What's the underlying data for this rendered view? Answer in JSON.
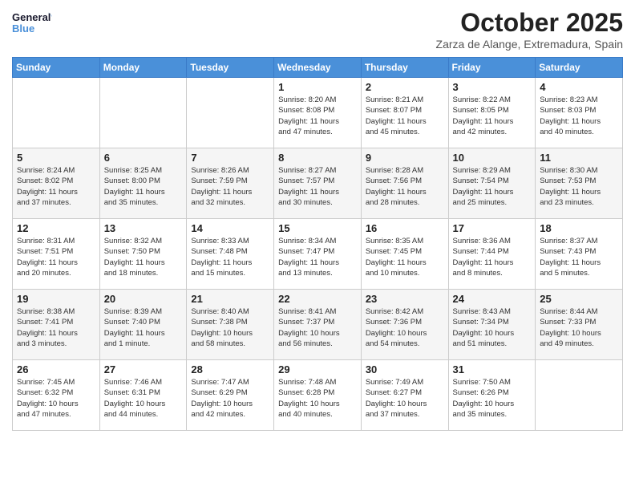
{
  "logo": {
    "line1": "General",
    "line2": "Blue"
  },
  "title": "October 2025",
  "subtitle": "Zarza de Alange, Extremadura, Spain",
  "days_of_week": [
    "Sunday",
    "Monday",
    "Tuesday",
    "Wednesday",
    "Thursday",
    "Friday",
    "Saturday"
  ],
  "weeks": [
    [
      {
        "day": "",
        "info": ""
      },
      {
        "day": "",
        "info": ""
      },
      {
        "day": "",
        "info": ""
      },
      {
        "day": "1",
        "info": "Sunrise: 8:20 AM\nSunset: 8:08 PM\nDaylight: 11 hours\nand 47 minutes."
      },
      {
        "day": "2",
        "info": "Sunrise: 8:21 AM\nSunset: 8:07 PM\nDaylight: 11 hours\nand 45 minutes."
      },
      {
        "day": "3",
        "info": "Sunrise: 8:22 AM\nSunset: 8:05 PM\nDaylight: 11 hours\nand 42 minutes."
      },
      {
        "day": "4",
        "info": "Sunrise: 8:23 AM\nSunset: 8:03 PM\nDaylight: 11 hours\nand 40 minutes."
      }
    ],
    [
      {
        "day": "5",
        "info": "Sunrise: 8:24 AM\nSunset: 8:02 PM\nDaylight: 11 hours\nand 37 minutes."
      },
      {
        "day": "6",
        "info": "Sunrise: 8:25 AM\nSunset: 8:00 PM\nDaylight: 11 hours\nand 35 minutes."
      },
      {
        "day": "7",
        "info": "Sunrise: 8:26 AM\nSunset: 7:59 PM\nDaylight: 11 hours\nand 32 minutes."
      },
      {
        "day": "8",
        "info": "Sunrise: 8:27 AM\nSunset: 7:57 PM\nDaylight: 11 hours\nand 30 minutes."
      },
      {
        "day": "9",
        "info": "Sunrise: 8:28 AM\nSunset: 7:56 PM\nDaylight: 11 hours\nand 28 minutes."
      },
      {
        "day": "10",
        "info": "Sunrise: 8:29 AM\nSunset: 7:54 PM\nDaylight: 11 hours\nand 25 minutes."
      },
      {
        "day": "11",
        "info": "Sunrise: 8:30 AM\nSunset: 7:53 PM\nDaylight: 11 hours\nand 23 minutes."
      }
    ],
    [
      {
        "day": "12",
        "info": "Sunrise: 8:31 AM\nSunset: 7:51 PM\nDaylight: 11 hours\nand 20 minutes."
      },
      {
        "day": "13",
        "info": "Sunrise: 8:32 AM\nSunset: 7:50 PM\nDaylight: 11 hours\nand 18 minutes."
      },
      {
        "day": "14",
        "info": "Sunrise: 8:33 AM\nSunset: 7:48 PM\nDaylight: 11 hours\nand 15 minutes."
      },
      {
        "day": "15",
        "info": "Sunrise: 8:34 AM\nSunset: 7:47 PM\nDaylight: 11 hours\nand 13 minutes."
      },
      {
        "day": "16",
        "info": "Sunrise: 8:35 AM\nSunset: 7:45 PM\nDaylight: 11 hours\nand 10 minutes."
      },
      {
        "day": "17",
        "info": "Sunrise: 8:36 AM\nSunset: 7:44 PM\nDaylight: 11 hours\nand 8 minutes."
      },
      {
        "day": "18",
        "info": "Sunrise: 8:37 AM\nSunset: 7:43 PM\nDaylight: 11 hours\nand 5 minutes."
      }
    ],
    [
      {
        "day": "19",
        "info": "Sunrise: 8:38 AM\nSunset: 7:41 PM\nDaylight: 11 hours\nand 3 minutes."
      },
      {
        "day": "20",
        "info": "Sunrise: 8:39 AM\nSunset: 7:40 PM\nDaylight: 11 hours\nand 1 minute."
      },
      {
        "day": "21",
        "info": "Sunrise: 8:40 AM\nSunset: 7:38 PM\nDaylight: 10 hours\nand 58 minutes."
      },
      {
        "day": "22",
        "info": "Sunrise: 8:41 AM\nSunset: 7:37 PM\nDaylight: 10 hours\nand 56 minutes."
      },
      {
        "day": "23",
        "info": "Sunrise: 8:42 AM\nSunset: 7:36 PM\nDaylight: 10 hours\nand 54 minutes."
      },
      {
        "day": "24",
        "info": "Sunrise: 8:43 AM\nSunset: 7:34 PM\nDaylight: 10 hours\nand 51 minutes."
      },
      {
        "day": "25",
        "info": "Sunrise: 8:44 AM\nSunset: 7:33 PM\nDaylight: 10 hours\nand 49 minutes."
      }
    ],
    [
      {
        "day": "26",
        "info": "Sunrise: 7:45 AM\nSunset: 6:32 PM\nDaylight: 10 hours\nand 47 minutes."
      },
      {
        "day": "27",
        "info": "Sunrise: 7:46 AM\nSunset: 6:31 PM\nDaylight: 10 hours\nand 44 minutes."
      },
      {
        "day": "28",
        "info": "Sunrise: 7:47 AM\nSunset: 6:29 PM\nDaylight: 10 hours\nand 42 minutes."
      },
      {
        "day": "29",
        "info": "Sunrise: 7:48 AM\nSunset: 6:28 PM\nDaylight: 10 hours\nand 40 minutes."
      },
      {
        "day": "30",
        "info": "Sunrise: 7:49 AM\nSunset: 6:27 PM\nDaylight: 10 hours\nand 37 minutes."
      },
      {
        "day": "31",
        "info": "Sunrise: 7:50 AM\nSunset: 6:26 PM\nDaylight: 10 hours\nand 35 minutes."
      },
      {
        "day": "",
        "info": ""
      }
    ]
  ]
}
